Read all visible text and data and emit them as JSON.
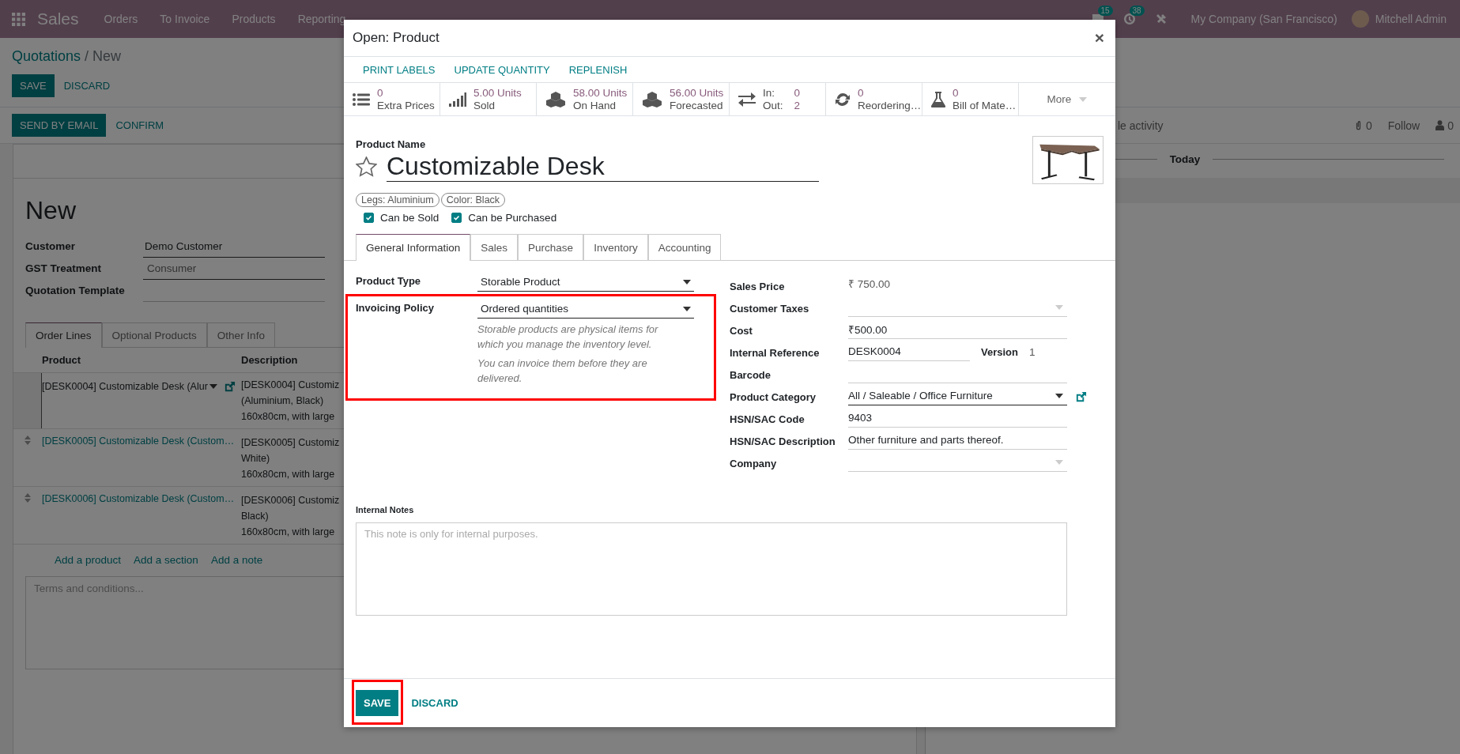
{
  "navbar": {
    "app": "Sales",
    "menu": [
      "Orders",
      "To Invoice",
      "Products",
      "Reporting"
    ],
    "messages_count": "15",
    "activities_count": "38",
    "company": "My Company (San Francisco)",
    "user": "Mitchell Admin"
  },
  "breadcrumb": {
    "parent": "Quotations",
    "separator": "/",
    "current": "New"
  },
  "form_buttons": [
    {
      "label": "SAVE",
      "kind": "primary"
    },
    {
      "label": "DISCARD",
      "kind": "link"
    }
  ],
  "status_buttons": [
    {
      "label": "SEND BY EMAIL",
      "kind": "primary"
    },
    {
      "label": "CONFIRM",
      "kind": "link"
    }
  ],
  "quotation": {
    "title": "New",
    "fields": [
      {
        "label": "Customer",
        "value": "Demo Customer",
        "kind": "input"
      },
      {
        "label": "GST Treatment",
        "value": "Consumer",
        "kind": "select"
      },
      {
        "label": "Quotation Template",
        "kind": "input"
      }
    ],
    "tabs": [
      {
        "label": "Order Lines",
        "selected": true
      },
      {
        "label": "Optional Products",
        "selected": false
      },
      {
        "label": "Other Info",
        "selected": false
      }
    ],
    "columns": [
      "Product",
      "Description"
    ],
    "lines": [
      {
        "product": "[DESK0004] Customizable Desk (Alur",
        "description": [
          "[DESK0004] Customiz",
          "(Aluminium, Black)",
          "160x80cm, with large"
        ],
        "editing": true
      },
      {
        "product": "[DESK0005] Customizable Desk (Custom…",
        "description": [
          "[DESK0005] Customiz",
          "White)",
          "160x80cm, with large"
        ],
        "editing": false
      },
      {
        "product": "[DESK0006] Customizable Desk (Custom…",
        "description": [
          "[DESK0006] Customiz",
          "Black)",
          "160x80cm, with large"
        ],
        "editing": false
      }
    ],
    "add_links": [
      "Add a product",
      "Add a section",
      "Add a note"
    ],
    "terms_placeholder": "Terms and conditions..."
  },
  "chatter": {
    "schedule": "le activity",
    "attachments": "0",
    "follow": "Follow",
    "followers": "0",
    "date_separator": "Today"
  },
  "dialog": {
    "title": "Open: Product",
    "close": "×",
    "actions": [
      "PRINT LABELS",
      "UPDATE QUANTITY",
      "REPLENISH"
    ],
    "stats": [
      {
        "kind": "list",
        "value": "0",
        "label": "Extra Prices"
      },
      {
        "kind": "bars",
        "value": "5.00 Units",
        "label": "Sold"
      },
      {
        "kind": "cubes",
        "value": "58.00 Units",
        "label": "On Hand"
      },
      {
        "kind": "cubes",
        "value": "56.00 Units",
        "label": "Forecasted"
      },
      {
        "kind": "transfers",
        "in_label": "In:",
        "in": "0",
        "out_label": "Out:",
        "out": "2"
      },
      {
        "kind": "refresh",
        "value": "0",
        "label": "Reordering…"
      },
      {
        "kind": "flask",
        "value": "0",
        "label": "Bill of Mate…"
      },
      {
        "kind": "more",
        "label": "More"
      }
    ],
    "name_label": "Product Name",
    "name": "Customizable Desk",
    "favorite": false,
    "attributes": [
      "Legs: Aluminium",
      "Color: Black"
    ],
    "options": [
      {
        "label": "Can be Sold",
        "checked": true
      },
      {
        "label": "Can be Purchased",
        "checked": true
      }
    ],
    "tabs": [
      {
        "label": "General Information",
        "selected": true
      },
      {
        "label": "Sales",
        "selected": false
      },
      {
        "label": "Purchase",
        "selected": false
      },
      {
        "label": "Inventory",
        "selected": false
      },
      {
        "label": "Accounting",
        "selected": false
      }
    ],
    "left_fields": [
      {
        "label": "Product Type",
        "value": "Storable Product",
        "kind": "select",
        "highlighted": false
      },
      {
        "label": "Invoicing Policy",
        "value": "Ordered quantities",
        "kind": "select",
        "highlighted": true,
        "help": [
          "Storable products are physical items for which you manage the inventory level.",
          "You can invoice them before they are delivered."
        ]
      }
    ],
    "right_fields": [
      {
        "label": "Sales Price",
        "value": "₹ 750.00",
        "kind": "plain"
      },
      {
        "label": "Customer Taxes",
        "kind": "select"
      },
      {
        "label": "Cost",
        "value": "₹500.00",
        "kind": "input"
      },
      {
        "label": "Internal Reference",
        "value": "DESK0004",
        "kind": "input",
        "extra_label": "Version",
        "extra_value": "1"
      },
      {
        "label": "Barcode",
        "kind": "input"
      },
      {
        "label": "Product Category",
        "value": "All / Saleable / Office Furniture",
        "kind": "select",
        "link": true
      },
      {
        "label": "HSN/SAC Code",
        "value": "9403",
        "kind": "input"
      },
      {
        "label": "HSN/SAC Description",
        "value": "Other furniture and parts thereof.",
        "kind": "input"
      },
      {
        "label": "Company",
        "kind": "select"
      }
    ],
    "notes_label": "Internal Notes",
    "notes_placeholder": "This note is only for internal purposes.",
    "footer": [
      {
        "label": "SAVE",
        "kind": "primary",
        "highlighted": true
      },
      {
        "label": "DISCARD",
        "kind": "link",
        "highlighted": false
      }
    ]
  }
}
